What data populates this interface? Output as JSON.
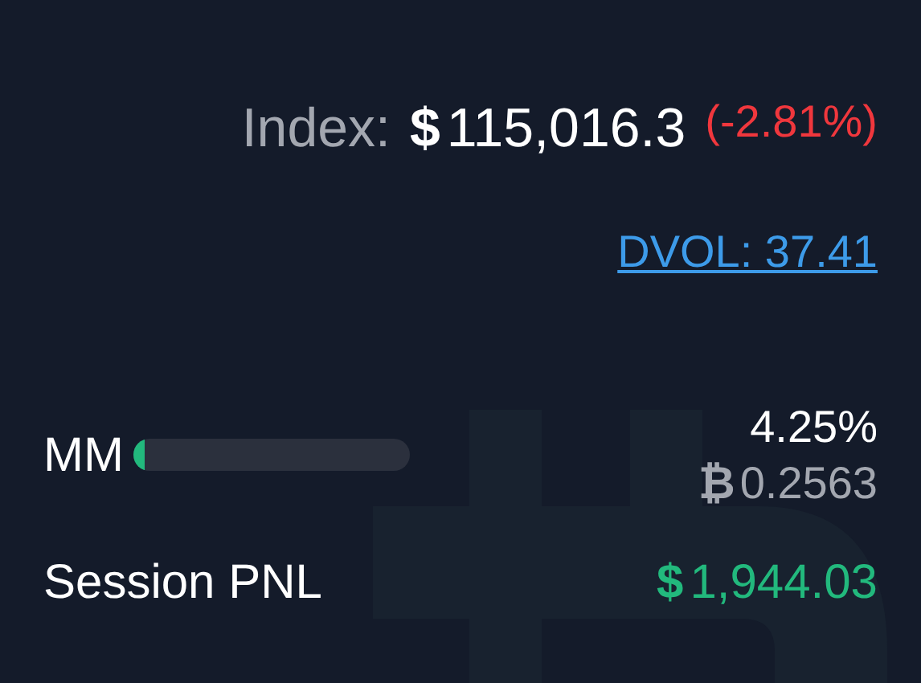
{
  "index": {
    "label": "Index:",
    "currency": "$",
    "value": "115,016.3",
    "change": "(-2.81%)",
    "negative": true
  },
  "dvol": {
    "text": "DVOL: 37.41"
  },
  "mm": {
    "label": "MM",
    "level": 0.0425,
    "percent": "4.25%",
    "btc_symbol": "₿",
    "btc_amount": "0.2563"
  },
  "session_pnl": {
    "label": "Session PNL",
    "currency": "$",
    "value": "1,944.03",
    "negative": false
  }
}
